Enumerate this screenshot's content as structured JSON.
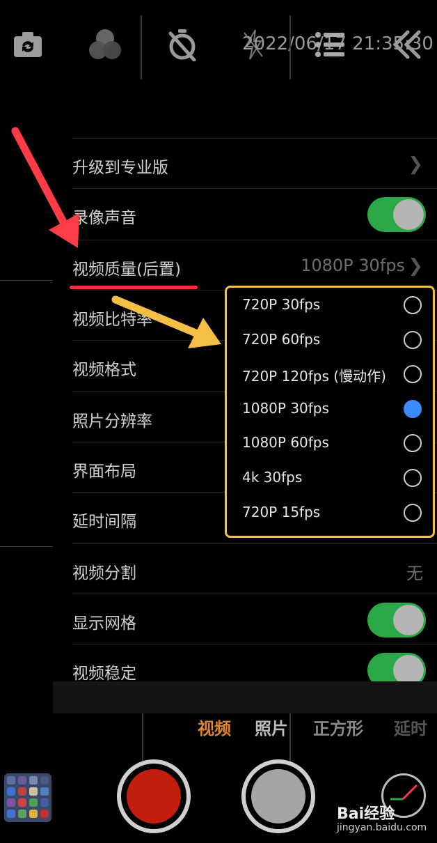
{
  "topbar": {
    "icons": [
      "switch-camera-icon",
      "color-filter-icon",
      "timer-off-icon",
      "flash-off-icon",
      "menu-icon",
      "collapse-icon"
    ],
    "timestamp": "2022/06/17 21:35:30"
  },
  "settings": {
    "items": [
      {
        "label": "升级到专业版",
        "value": "",
        "type": "chevron"
      },
      {
        "label": "录像声音",
        "value": "",
        "type": "toggle",
        "on": true
      },
      {
        "label": "视频质量(后置)",
        "value": "1080P 30fps",
        "type": "chevron"
      },
      {
        "label": "视频比特率",
        "value": "",
        "type": "hidden"
      },
      {
        "label": "视频格式",
        "value": "",
        "type": "hidden"
      },
      {
        "label": "照片分辨率",
        "value": "",
        "type": "hidden"
      },
      {
        "label": "界面布局",
        "value": "",
        "type": "hidden"
      },
      {
        "label": "延时间隔",
        "value": "",
        "type": "hidden"
      },
      {
        "label": "视频分割",
        "value": "无",
        "type": "value"
      },
      {
        "label": "显示网格",
        "value": "",
        "type": "toggle",
        "on": true
      },
      {
        "label": "视频稳定",
        "value": "",
        "type": "toggle",
        "on": true
      }
    ]
  },
  "quality_popup": {
    "options": [
      {
        "label": "720P 30fps",
        "selected": false
      },
      {
        "label": "720P 60fps",
        "selected": false
      },
      {
        "label": "720P 120fps (慢动作)",
        "selected": false
      },
      {
        "label": "1080P 30fps",
        "selected": true
      },
      {
        "label": "1080P 60fps",
        "selected": false
      },
      {
        "label": "4k 30fps",
        "selected": false
      },
      {
        "label": "720P 15fps",
        "selected": false
      }
    ]
  },
  "modes": {
    "items": [
      "视频",
      "照片",
      "正方形",
      "延时"
    ],
    "active": "视频"
  },
  "watermark": {
    "brand": "Bai经验",
    "url": "jingyan.baidu.com"
  },
  "colors": {
    "accent": "#e0862a",
    "toggle_on": "#2aa845",
    "radio_selected": "#3c8cff",
    "popup_border": "#f4bf45",
    "arrow_red": "#ff3b47",
    "underline_red": "#ff2d3d",
    "record_red": "#c21d0e"
  }
}
